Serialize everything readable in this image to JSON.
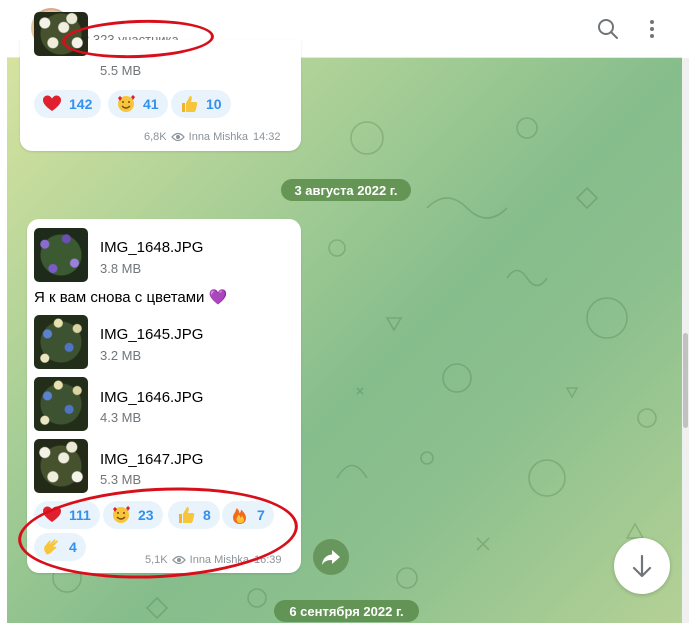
{
  "header": {
    "members_count": "3 323 участника"
  },
  "messages": [
    {
      "file_size": "5.5 MB",
      "reactions": [
        {
          "emoji": "red-heart",
          "count": "142"
        },
        {
          "emoji": "smiling-face-with-hearts",
          "count": "41"
        },
        {
          "emoji": "thumbs-up",
          "count": "10"
        }
      ],
      "views": "6,8K",
      "author": "Inna Mishka",
      "time": "14:32"
    },
    {
      "files_top": [
        {
          "name": "IMG_1648.JPG",
          "size": "3.8 MB"
        }
      ],
      "caption": "Я к вам снова с цветами 💜",
      "files": [
        {
          "name": "IMG_1645.JPG",
          "size": "3.2 MB"
        },
        {
          "name": "IMG_1646.JPG",
          "size": "4.3 MB"
        },
        {
          "name": "IMG_1647.JPG",
          "size": "5.3 MB"
        }
      ],
      "reactions": [
        {
          "emoji": "red-heart",
          "count": "111"
        },
        {
          "emoji": "smiling-face-with-hearts",
          "count": "23"
        },
        {
          "emoji": "thumbs-up",
          "count": "8"
        },
        {
          "emoji": "fire",
          "count": "7"
        },
        {
          "emoji": "clapping-hands",
          "count": "4"
        }
      ],
      "views": "5,1K",
      "author": "Inna Mishka",
      "time": "16:39"
    }
  ],
  "dates": {
    "first": "3 августа 2022 г.",
    "second": "6 сентября 2022 г."
  },
  "colors": {
    "accent": "#3390ec",
    "annotation": "#d80f1a",
    "reaction_bg": "#e9f3fc"
  }
}
